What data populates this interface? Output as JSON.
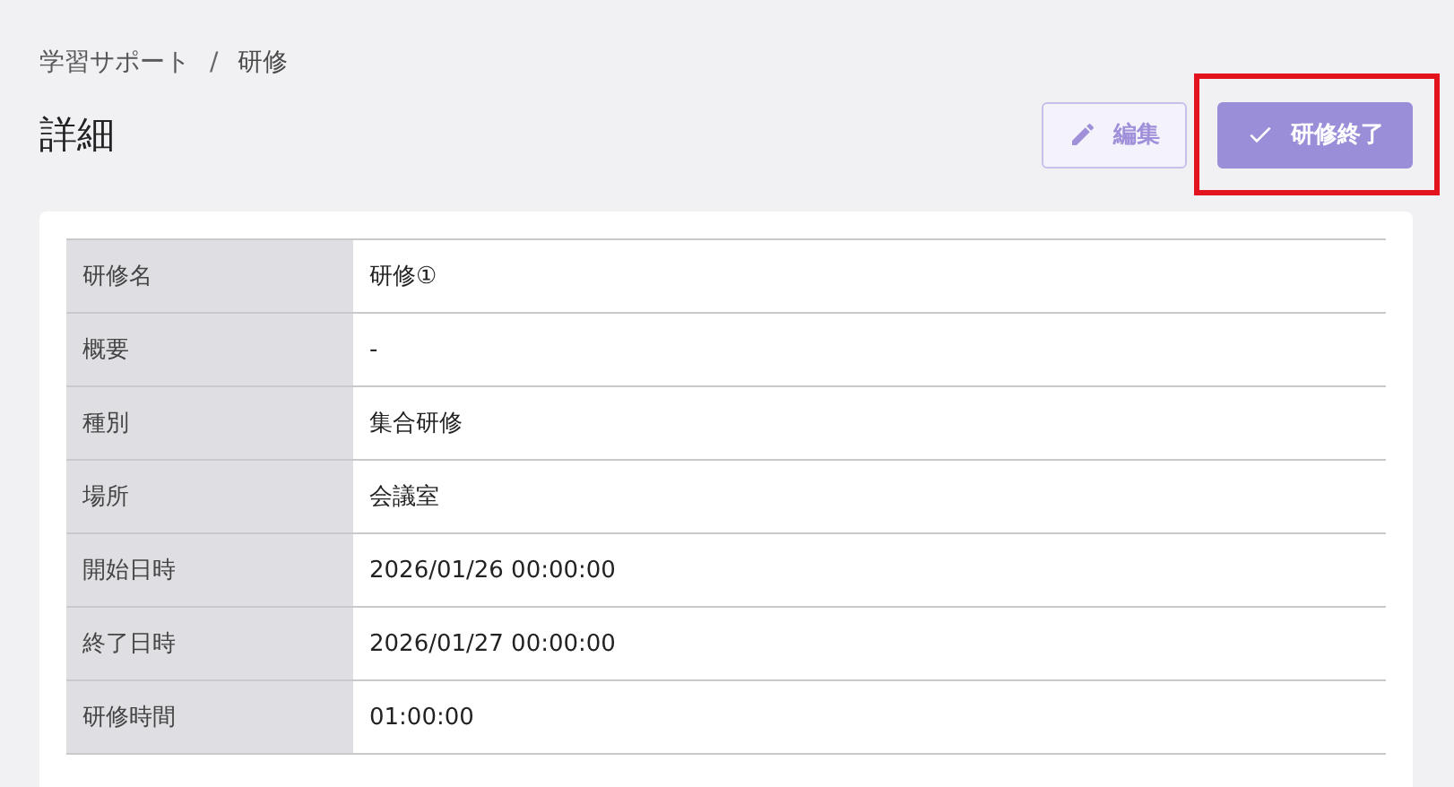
{
  "breadcrumb": [
    {
      "label": "学習サポート",
      "kind": "link"
    },
    {
      "label": "/",
      "kind": "separator"
    },
    {
      "label": "研修",
      "kind": "current"
    }
  ],
  "title": "詳細",
  "buttons": [
    {
      "label": "編集",
      "kind": "outline",
      "highlighted": false
    },
    {
      "label": "研修終了",
      "kind": "primary",
      "highlighted": true
    }
  ],
  "details": [
    {
      "label": "研修名",
      "value": "研修①"
    },
    {
      "label": "概要",
      "value": "-"
    },
    {
      "label": "種別",
      "value": "集合研修"
    },
    {
      "label": "場所",
      "value": "会議室"
    },
    {
      "label": "開始日時",
      "value": "2026/01/26 00:00:00"
    },
    {
      "label": "終了日時",
      "value": "2026/01/27 00:00:00"
    },
    {
      "label": "研修時間",
      "value": "01:00:00"
    }
  ]
}
